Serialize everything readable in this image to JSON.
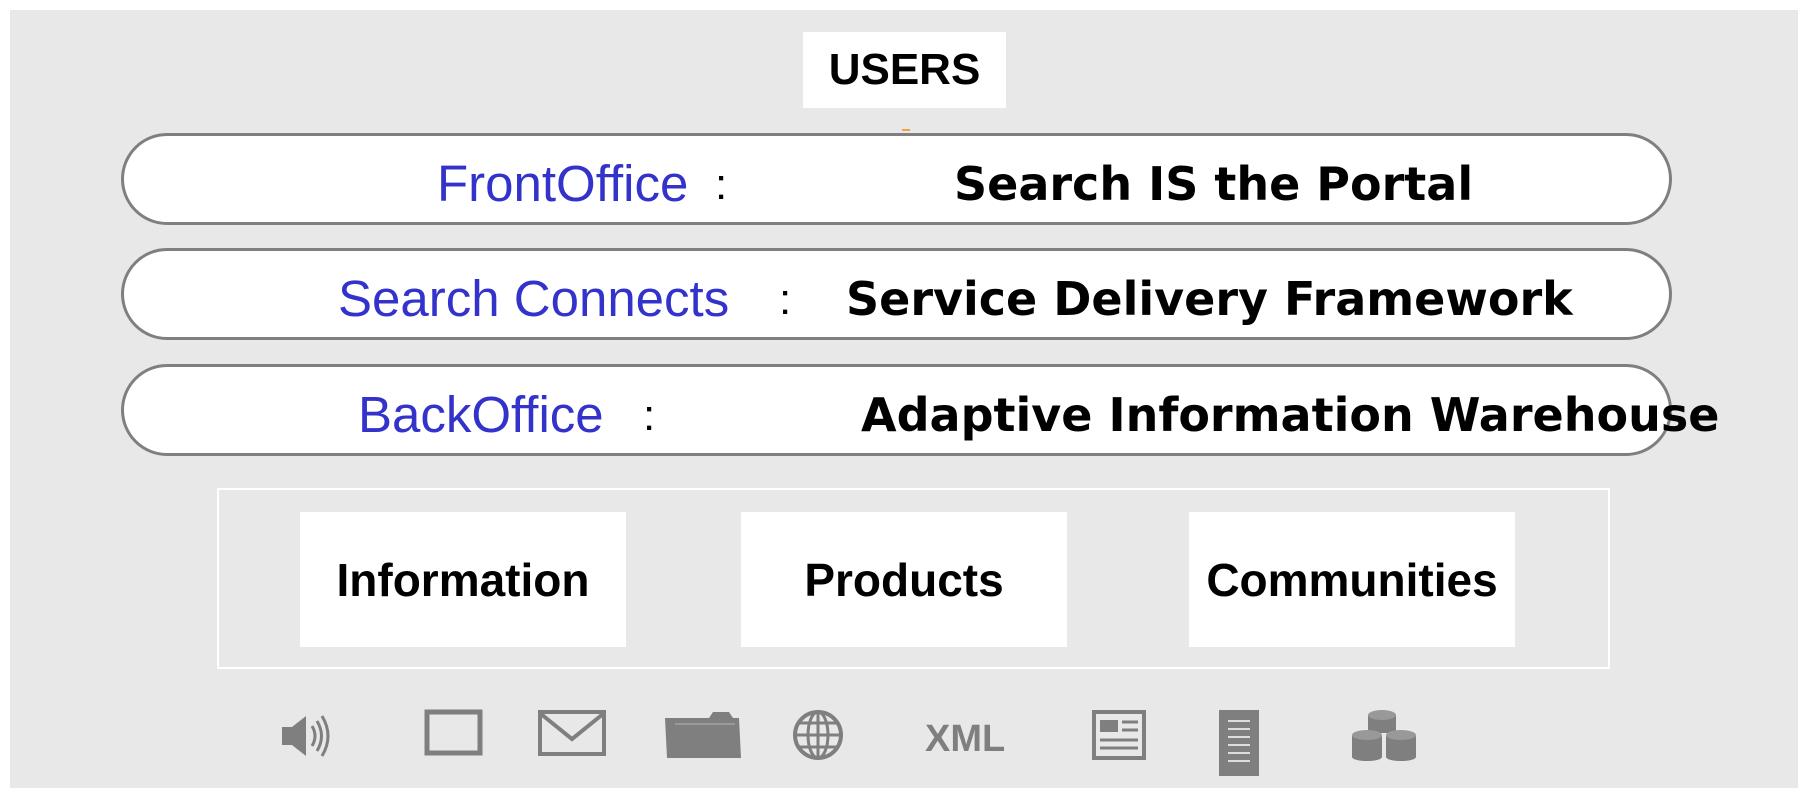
{
  "top": {
    "label": "USERS"
  },
  "layers": [
    {
      "name": "FrontOffice",
      "colon": ":",
      "description": "Search IS the Portal"
    },
    {
      "name": "Search Connects",
      "colon": ":",
      "description": "Service Delivery Framework"
    },
    {
      "name": "BackOffice",
      "colon": ":",
      "description": "Adaptive Information Warehouse"
    }
  ],
  "repositories": [
    "Information",
    "Products",
    "Communities"
  ],
  "sources": {
    "icons": [
      "speaker-icon",
      "document-frame-icon",
      "envelope-icon",
      "folder-icon",
      "globe-icon",
      "xml-icon",
      "news-page-icon",
      "server-icon",
      "database-icon"
    ],
    "xml_label": "XML"
  },
  "colors": {
    "accent": "#3333cc",
    "outline": "#7f7f7f",
    "icon": "#7f7f7f",
    "background": "#e8e8e8"
  }
}
